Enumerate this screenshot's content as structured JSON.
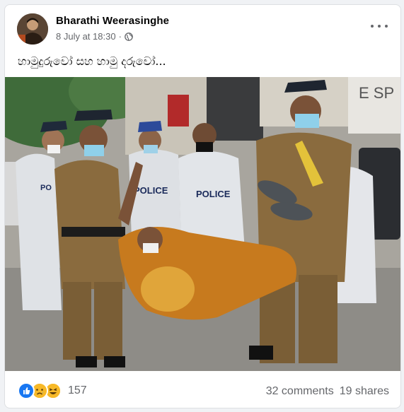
{
  "post": {
    "author": "Bharathi Weerasinghe",
    "timestamp": "8 July at 18:30",
    "separator": "·",
    "privacy_icon": "globe-icon",
    "caption": "හාමුදුරුවෝ සහ හාමු දරුවෝ...",
    "photo_text": {
      "police_left": "POLICE",
      "police_center": "POLICE",
      "police_left_partial": "PO",
      "shop_sign": "E SP"
    },
    "reactions": {
      "icons": [
        "like-icon",
        "sad-icon",
        "haha-icon"
      ],
      "count": "157"
    },
    "comments": "32 comments",
    "shares": "19 shares"
  },
  "colors": {
    "like": "#1877f2",
    "emoji": "#f7b928",
    "meta": "#65676b",
    "khaki": "#8a6b3e",
    "robe": "#c77a1e",
    "ppe": "#d9dde2"
  }
}
